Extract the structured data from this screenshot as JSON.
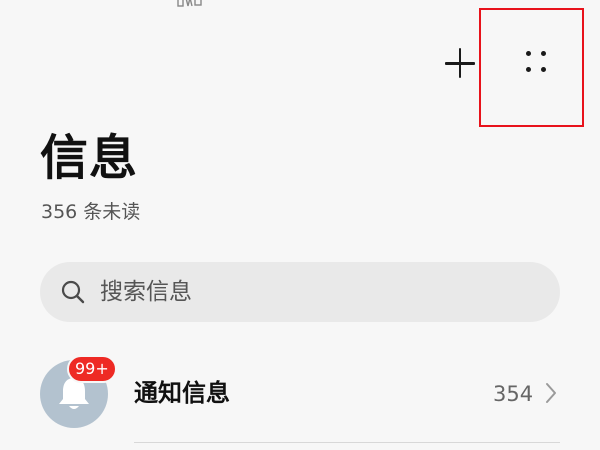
{
  "header": {
    "title": "信息",
    "unread_summary": "356 条未读",
    "add_icon": "plus-icon",
    "more_icon": "more-dots-icon"
  },
  "search": {
    "placeholder": "搜索信息",
    "icon": "search-icon"
  },
  "conversations": [
    {
      "name": "通知信息",
      "count": "354",
      "badge": "99+",
      "avatar_icon": "bell-icon",
      "badge_color": "#ee2a24"
    }
  ],
  "colors": {
    "background": "#f7f7f7",
    "highlight_frame": "#e8121b",
    "badge": "#ee2a24",
    "avatar": "#b3c2cf"
  }
}
